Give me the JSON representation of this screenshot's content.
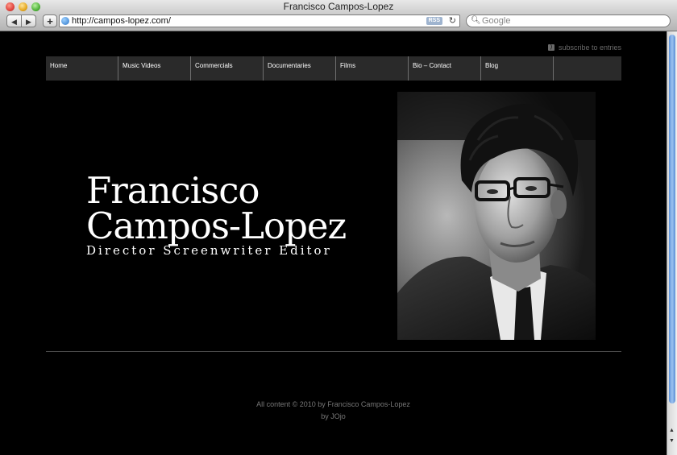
{
  "window": {
    "title": "Francisco Campos-Lopez"
  },
  "toolbar": {
    "back_label": "◀",
    "forward_label": "▶",
    "add_label": "+",
    "url": "http://campos-lopez.com/",
    "rss_label": "RSS",
    "reload_label": "↻",
    "search_placeholder": "Google"
  },
  "page": {
    "subscribe_label": "subscribe to entries",
    "menu": [
      {
        "label": "Home"
      },
      {
        "label": "Music Videos"
      },
      {
        "label": "Commercials"
      },
      {
        "label": "Documentaries"
      },
      {
        "label": "Films"
      },
      {
        "label": "Bio – Contact"
      },
      {
        "label": "Blog"
      }
    ],
    "name_line1": "Francisco",
    "name_line2": "Campos-Lopez",
    "roles": "Director Screenwriter Editor",
    "footer_line1": "All content © 2010 by Francisco Campos-Lopez",
    "footer_line2": "by JOjo"
  },
  "colors": {
    "page_bg": "#000000",
    "menu_bg": "#2a2a2a",
    "text": "#ffffff"
  }
}
